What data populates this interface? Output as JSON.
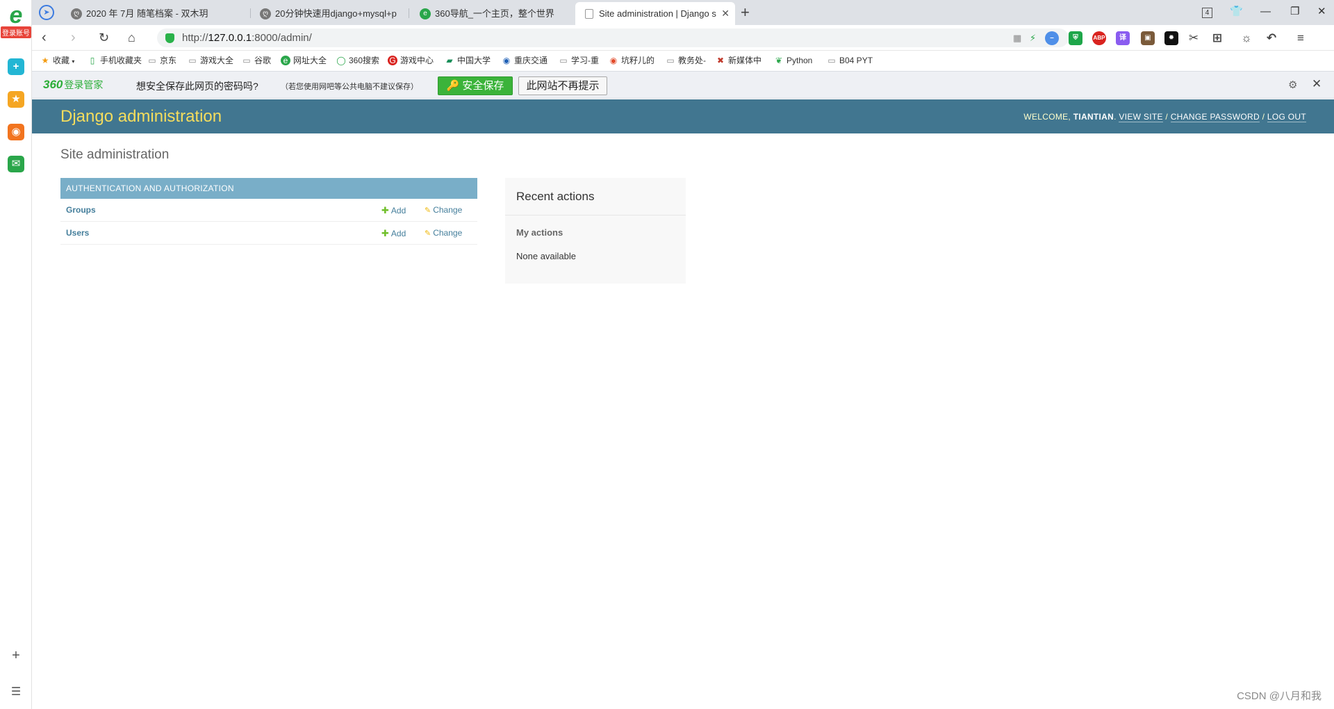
{
  "browser": {
    "rail": {
      "logo": "e",
      "login_badge": "登录账号"
    },
    "tabs": [
      {
        "title": "2020 年 7月 随笔档案 - 双木玥",
        "active": false
      },
      {
        "title": "20分钟快速用django+mysql+p",
        "active": false
      },
      {
        "title": "360导航_一个主页，整个世界",
        "active": false
      },
      {
        "title": "Site administration | Django s",
        "active": true
      }
    ],
    "tab_count": "4",
    "url": {
      "scheme": "http://",
      "host": "127.0.0.1",
      "rest": ":8000/admin/"
    },
    "extensions": [
      {
        "name": "adblock-icon",
        "label": "ABP",
        "color": "#d9231f"
      },
      {
        "name": "translate-icon",
        "label": "译",
        "color": "#8a5cf0"
      }
    ],
    "bookmarks": [
      {
        "label": "收藏",
        "icon": "star-icon",
        "color": "#f39c12"
      },
      {
        "label": "手机收藏夹",
        "icon": "phone-icon",
        "color": "#2aa64a"
      },
      {
        "label": "京东",
        "icon": "page-icon",
        "color": "#888888"
      },
      {
        "label": "游戏大全",
        "icon": "page-icon",
        "color": "#888888"
      },
      {
        "label": "谷歌",
        "icon": "page-icon",
        "color": "#888888"
      },
      {
        "label": "网址大全",
        "icon": "360-icon",
        "color": "#2aa64a"
      },
      {
        "label": "360搜索",
        "icon": "search-360-icon",
        "color": "#2aa64a"
      },
      {
        "label": "游戏中心",
        "icon": "game-icon",
        "color": "#d9231f"
      },
      {
        "label": "中国大学",
        "icon": "book-icon",
        "color": "#1a8f5a"
      },
      {
        "label": "重庆交通",
        "icon": "school-icon",
        "color": "#1e5fb5"
      },
      {
        "label": "学习-重",
        "icon": "page-icon",
        "color": "#888888"
      },
      {
        "label": "坑籽儿的",
        "icon": "weibo-icon",
        "color": "#e24a2a"
      },
      {
        "label": "教务处-",
        "icon": "page-icon",
        "color": "#888888"
      },
      {
        "label": "新媒体中",
        "icon": "media-icon",
        "color": "#c0392b"
      },
      {
        "label": "Python",
        "icon": "leaf-icon",
        "color": "#2aa64a"
      },
      {
        "label": "B04 PYT",
        "icon": "page-icon",
        "color": "#888888"
      }
    ]
  },
  "password_bar": {
    "brand": "360",
    "brand_suffix": "登录管家",
    "question": "想安全保存此网页的密码吗?",
    "note": "（若您使用网吧等公共电脑不建议保存）",
    "save_label": "安全保存",
    "never_label": "此网站不再提示"
  },
  "django": {
    "branding": "Django administration",
    "welcome": "WELCOME,",
    "username": "TIANTIAN",
    "view_site": "VIEW SITE",
    "change_password": "CHANGE PASSWORD",
    "log_out": "LOG OUT",
    "page_title": "Site administration",
    "app_caption": "AUTHENTICATION AND AUTHORIZATION",
    "models": [
      {
        "name": "Groups",
        "add": "Add",
        "change": "Change"
      },
      {
        "name": "Users",
        "add": "Add",
        "change": "Change"
      }
    ],
    "recent_actions_title": "Recent actions",
    "my_actions": "My actions",
    "none_available": "None available"
  },
  "watermark": "CSDN @八月和我",
  "colors": {
    "header_bg": "#417690",
    "branding": "#f5dd5d",
    "caption_bg": "#79aec8",
    "link": "#447e9b",
    "add_green": "#70bf2b",
    "change_yellow": "#efb80b"
  }
}
